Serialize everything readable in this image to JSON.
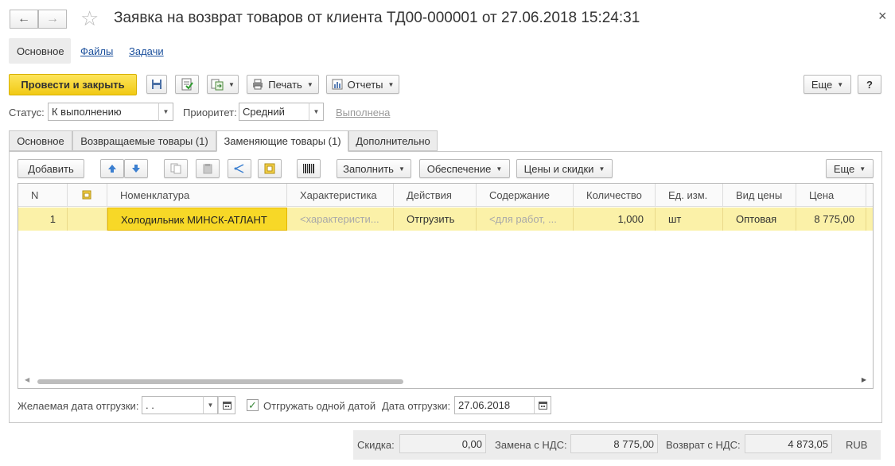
{
  "window": {
    "title": "Заявка на возврат товаров от клиента ТД00-000001 от 27.06.2018 15:24:31",
    "close_glyph": "×",
    "back_glyph": "←",
    "forward_glyph": "→",
    "star_glyph": "☆"
  },
  "nav_tabs": {
    "main": "Основное",
    "files": "Файлы",
    "tasks": "Задачи"
  },
  "toolbar": {
    "post_close": "Провести и закрыть",
    "print": "Печать",
    "reports": "Отчеты",
    "more": "Еще",
    "help": "?"
  },
  "status": {
    "status_label": "Статус:",
    "status_value": "К выполнению",
    "priority_label": "Приоритет:",
    "priority_value": "Средний",
    "done_link": "Выполнена"
  },
  "tabs": [
    "Основное",
    "Возвращаемые товары (1)",
    "Заменяющие товары (1)",
    "Дополнительно"
  ],
  "table_toolbar": {
    "add": "Добавить",
    "fill": "Заполнить",
    "supply": "Обеспечение",
    "prices": "Цены и скидки",
    "more": "Еще"
  },
  "table": {
    "columns": [
      "N",
      "Номенклатура",
      "Характеристика",
      "Действия",
      "Содержание",
      "Количество",
      "Ед. изм.",
      "Вид цены",
      "Цена"
    ],
    "rows": [
      {
        "n": "1",
        "item": "Холодильник МИНСК-АТЛАНТ",
        "characteristic": "<характеристи...",
        "action": "Отгрузить",
        "content": "<для работ, ...",
        "qty": "1,000",
        "unit": "шт",
        "price_type": "Оптовая",
        "price": "8 775,00"
      }
    ]
  },
  "bottom": {
    "desired_date_label": "Желаемая дата отгрузки:",
    "desired_date_value": " .  .",
    "ship_one_date_label": "Отгружать одной датой",
    "ship_date_label": "Дата отгрузки:",
    "ship_date_value": "27.06.2018",
    "ship_one_date_checked": true
  },
  "totals": {
    "discount_label": "Скидка:",
    "discount_value": "0,00",
    "replacement_label": "Замена с НДС:",
    "replacement_value": "8 775,00",
    "return_label": "Возврат с НДС:",
    "return_value": "4 873,05",
    "currency": "RUB"
  },
  "colors": {
    "accent_yellow": "#f1c914",
    "selected_row": "#fbf1a8",
    "link": "#1a4f9c"
  }
}
